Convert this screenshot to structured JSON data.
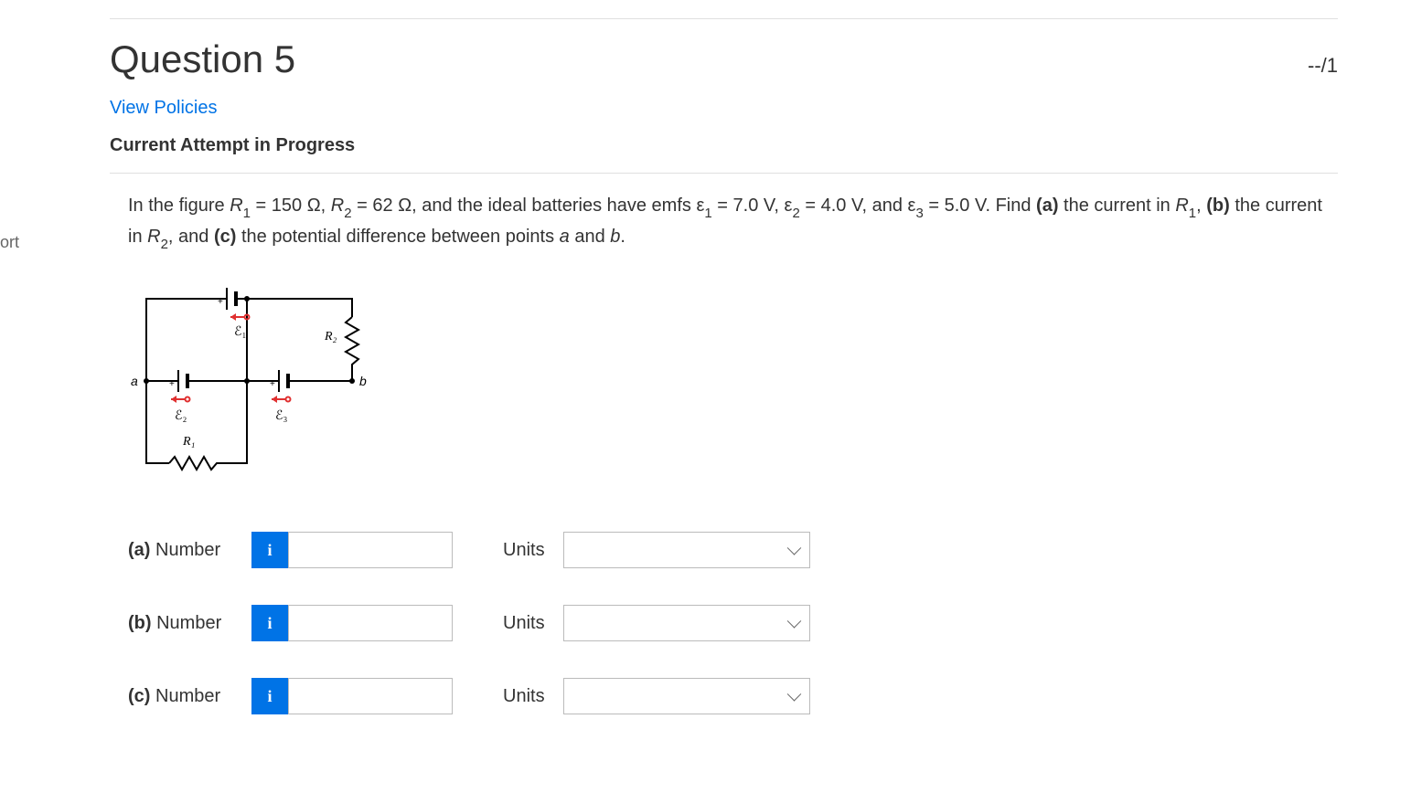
{
  "sidebar": {
    "fragment": "ort"
  },
  "header": {
    "title": "Question 5",
    "score": "--/1"
  },
  "links": {
    "view_policies": "View Policies"
  },
  "attempt": {
    "label": "Current Attempt in Progress"
  },
  "problem": {
    "R1_value": "150",
    "R2_value": "62",
    "e1_value": "7.0",
    "e2_value": "4.0",
    "e3_value": "5.0",
    "ohm": "Ω",
    "volt": "V"
  },
  "diagram": {
    "labels": {
      "a": "a",
      "b": "b",
      "E1": "ℰ₁",
      "E2": "ℰ₂",
      "E3": "ℰ₃",
      "R1": "R₁",
      "R2": "R₂"
    }
  },
  "answers": {
    "a": {
      "label": "(a) Number",
      "units_label": "Units",
      "value": "",
      "units_value": ""
    },
    "b": {
      "label": "(b) Number",
      "units_label": "Units",
      "value": "",
      "units_value": ""
    },
    "c": {
      "label": "(c) Number",
      "units_label": "Units",
      "value": "",
      "units_value": ""
    }
  }
}
